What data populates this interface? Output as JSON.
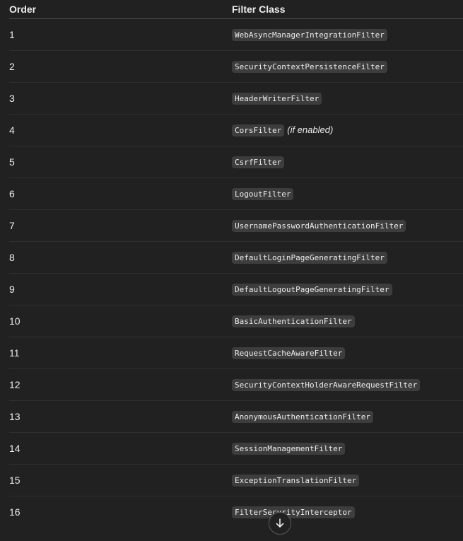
{
  "table": {
    "headers": [
      "Order",
      "Filter Class"
    ],
    "rows": [
      {
        "order": "1",
        "filter_class": "WebAsyncManagerIntegrationFilter",
        "note": ""
      },
      {
        "order": "2",
        "filter_class": "SecurityContextPersistenceFilter",
        "note": ""
      },
      {
        "order": "3",
        "filter_class": "HeaderWriterFilter",
        "note": ""
      },
      {
        "order": "4",
        "filter_class": "CorsFilter",
        "note": "(if enabled)"
      },
      {
        "order": "5",
        "filter_class": "CsrfFilter",
        "note": ""
      },
      {
        "order": "6",
        "filter_class": "LogoutFilter",
        "note": ""
      },
      {
        "order": "7",
        "filter_class": "UsernamePasswordAuthenticationFilter",
        "note": ""
      },
      {
        "order": "8",
        "filter_class": "DefaultLoginPageGeneratingFilter",
        "note": ""
      },
      {
        "order": "9",
        "filter_class": "DefaultLogoutPageGeneratingFilter",
        "note": ""
      },
      {
        "order": "10",
        "filter_class": "BasicAuthenticationFilter",
        "note": ""
      },
      {
        "order": "11",
        "filter_class": "RequestCacheAwareFilter",
        "note": ""
      },
      {
        "order": "12",
        "filter_class": "SecurityContextHolderAwareRequestFilter",
        "note": ""
      },
      {
        "order": "13",
        "filter_class": "AnonymousAuthenticationFilter",
        "note": ""
      },
      {
        "order": "14",
        "filter_class": "SessionManagementFilter",
        "note": ""
      },
      {
        "order": "15",
        "filter_class": "ExceptionTranslationFilter",
        "note": ""
      },
      {
        "order": "16",
        "filter_class": "FilterSecurityInterceptor",
        "note": ""
      }
    ]
  },
  "scroll_button": {
    "icon": "arrow-down-icon"
  },
  "colors": {
    "background": "#212121",
    "text": "#ececec",
    "code_background": "#3d3d3d",
    "row_divider": "#2f2f2f"
  }
}
